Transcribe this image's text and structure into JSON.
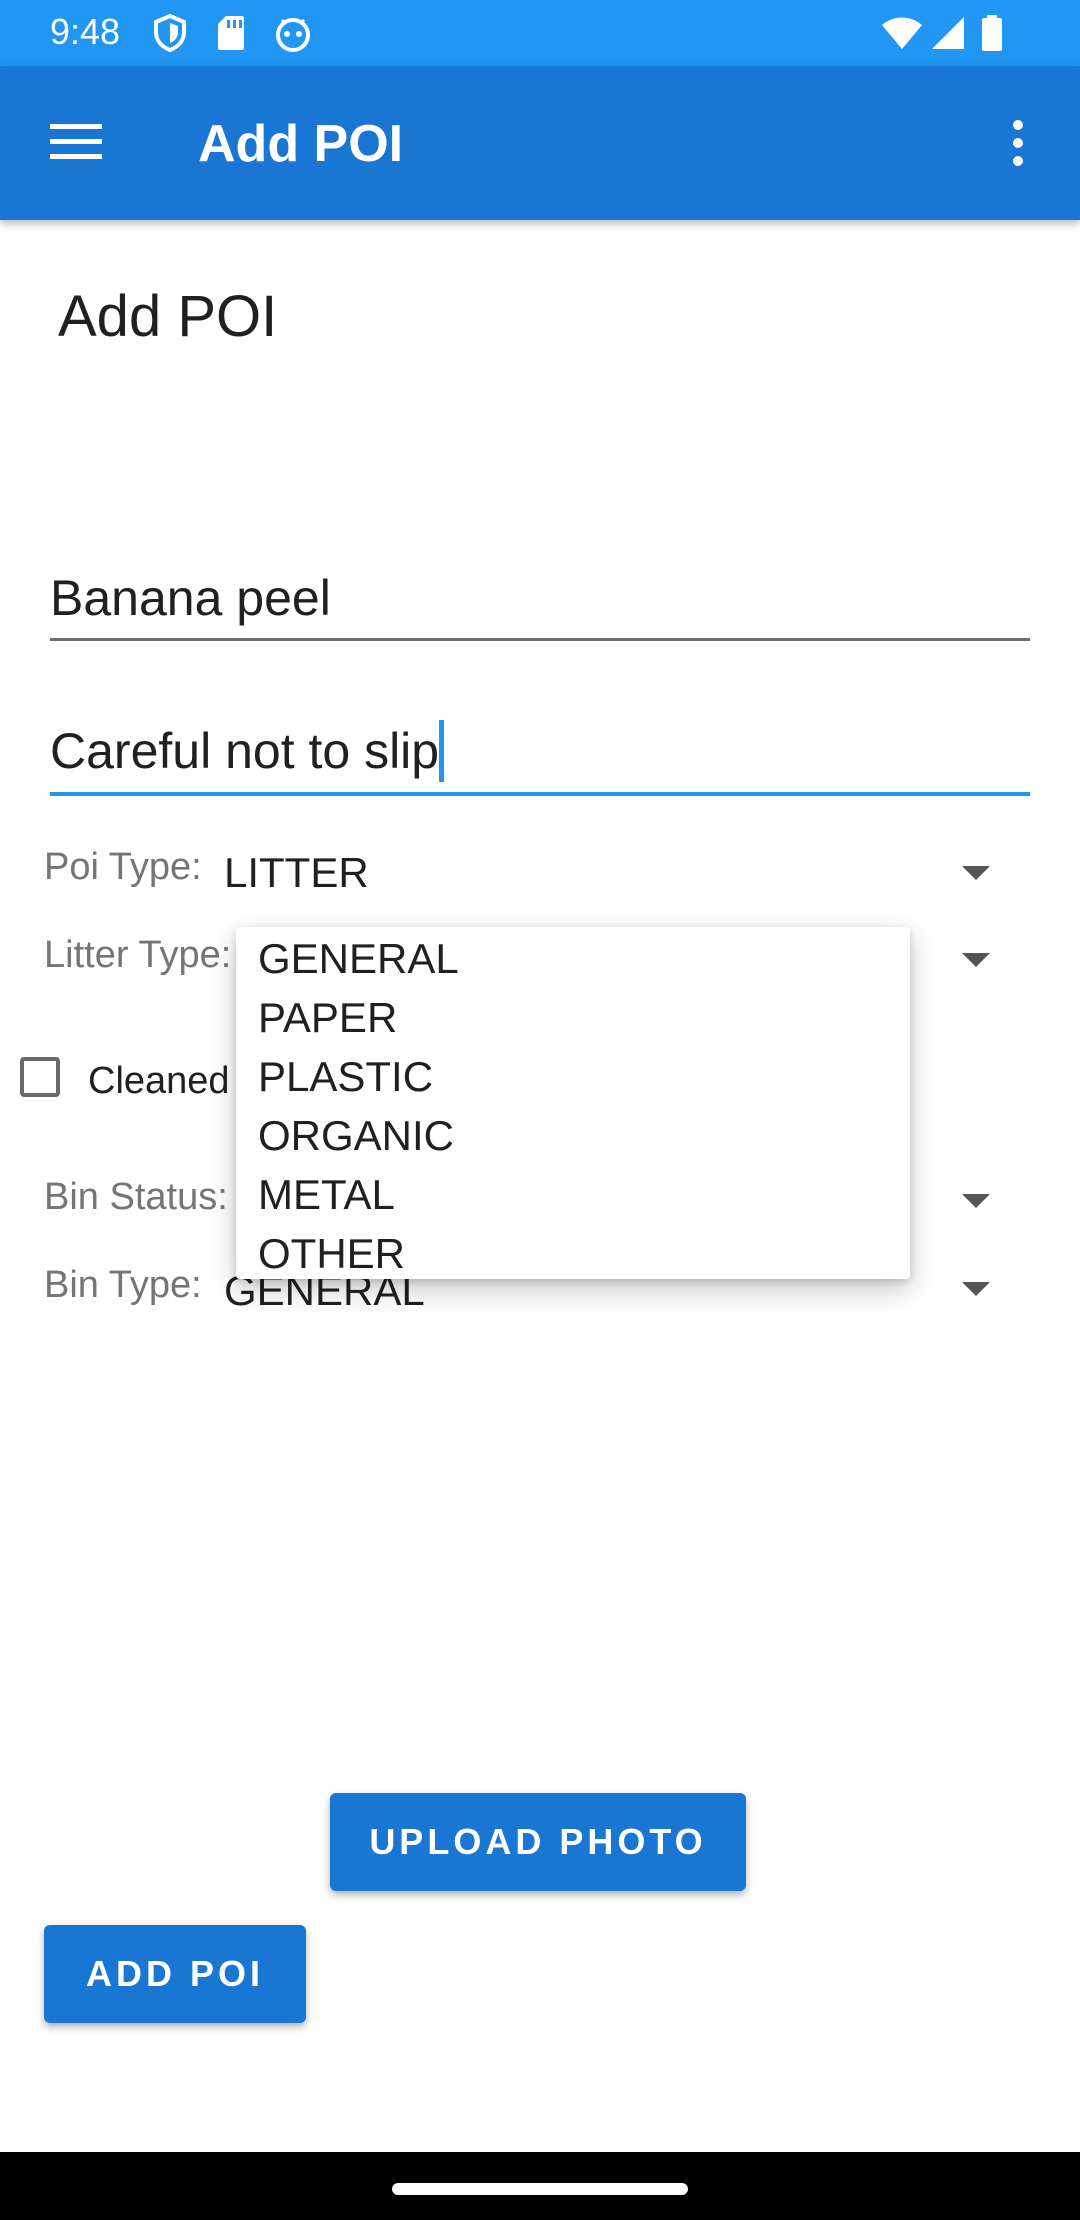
{
  "status_bar": {
    "time": "9:48",
    "left_icons": [
      "shield-icon",
      "sd-card-icon",
      "android-debug-icon"
    ],
    "right_icons": [
      "wifi-icon",
      "cell-signal-icon",
      "battery-icon"
    ],
    "color": "#2196f3"
  },
  "app_bar": {
    "title": "Add POI",
    "menu_icon": "hamburger-menu-icon",
    "overflow_icon": "more-vert-icon",
    "color": "#1976d2"
  },
  "form": {
    "heading": "Add POI",
    "name_value": "Banana peel",
    "description_value": "Careful not to slip",
    "poi_type": {
      "label": "Poi Type:",
      "value": "LITTER"
    },
    "litter_type": {
      "label": "Litter Type:",
      "value": ""
    },
    "cleaned": {
      "label": "Cleaned",
      "checked": false
    },
    "bin_status": {
      "label": "Bin Status:",
      "value": ""
    },
    "bin_type": {
      "label": "Bin Type:",
      "value": "GENERAL"
    }
  },
  "litter_dropdown": {
    "options": [
      "GENERAL",
      "PAPER",
      "PLASTIC",
      "ORGANIC",
      "METAL",
      "OTHER"
    ]
  },
  "buttons": {
    "upload_photo": "UPLOAD PHOTO",
    "add_poi": "ADD POI"
  },
  "colors": {
    "accent": "#1976d2",
    "focus_line": "#2196f3"
  }
}
